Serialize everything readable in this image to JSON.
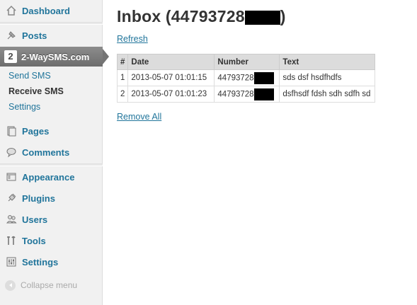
{
  "sidebar": {
    "dashboard": "Dashboard",
    "posts": "Posts",
    "plugin_logo": "2",
    "plugin": "2-WaySMS.com",
    "submenu": [
      "Send SMS",
      "Receive SMS",
      "Settings"
    ],
    "pages": "Pages",
    "comments": "Comments",
    "appearance": "Appearance",
    "plugins": "Plugins",
    "users": "Users",
    "tools": "Tools",
    "settings": "Settings",
    "collapse": "Collapse menu"
  },
  "main": {
    "title_prefix": "Inbox (44793728",
    "title_suffix": ")",
    "refresh": "Refresh",
    "remove_all": "Remove All",
    "table": {
      "headers": [
        "#",
        "Date",
        "Number",
        "Text"
      ],
      "rows": [
        {
          "n": "1",
          "date": "2013-05-07 01:01:15",
          "number": "44793728",
          "text": "sds dsf hsdfhdfs"
        },
        {
          "n": "2",
          "date": "2013-05-07 01:01:23",
          "number": "44793728",
          "text": "dsfhsdf fdsh sdh sdfh sd"
        }
      ]
    }
  },
  "colors": {
    "link": "#21759b",
    "sidebar_bg": "#f1f1f1",
    "current_menu": "#777777"
  },
  "icons": [
    "dashboard-icon",
    "posts-icon",
    "pages-icon",
    "comments-icon",
    "appearance-icon",
    "plugins-icon",
    "users-icon",
    "tools-icon",
    "settings-icon",
    "collapse-icon"
  ]
}
